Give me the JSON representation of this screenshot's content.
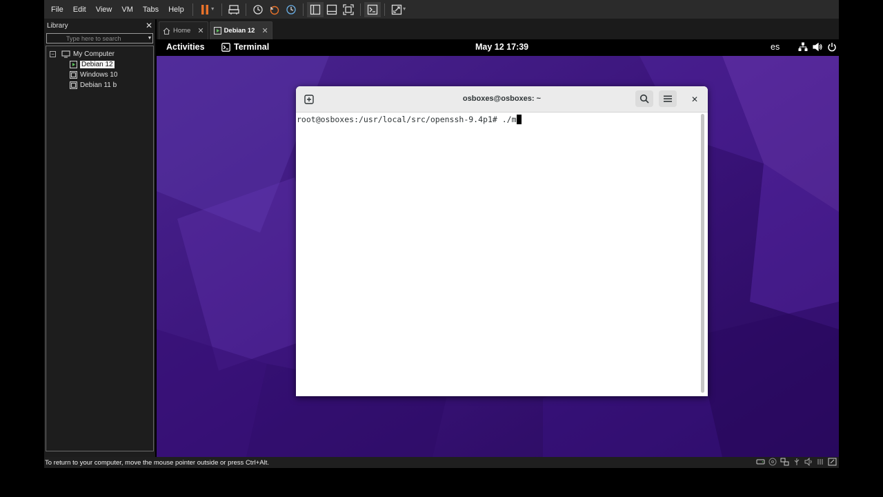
{
  "menubar": {
    "items": [
      "File",
      "Edit",
      "View",
      "VM",
      "Tabs",
      "Help"
    ]
  },
  "library": {
    "title": "Library",
    "search_placeholder": "Type here to search",
    "tree": {
      "root": "My Computer",
      "vms": [
        "Debian 12",
        "Windows 10",
        "Debian 11 b"
      ],
      "selected": "Debian 12"
    }
  },
  "tabs": [
    {
      "label": "Home",
      "active": false
    },
    {
      "label": "Debian 12",
      "active": true
    }
  ],
  "gnome": {
    "activities": "Activities",
    "app_name": "Terminal",
    "clock": "May 12  17:39",
    "keyboard_layout": "es"
  },
  "terminal": {
    "title": "osboxes@osboxes: ~",
    "prompt": "root@osboxes:/usr/local/src/openssh-9.4p1# ",
    "input": "./m"
  },
  "statusbar": {
    "message": "To return to your computer, move the mouse pointer outside or press Ctrl+Alt."
  },
  "colors": {
    "vmware_chrome": "#2b2b2b",
    "wallpaper_base": "#3a1474",
    "pause_accent": "#e8722a"
  }
}
